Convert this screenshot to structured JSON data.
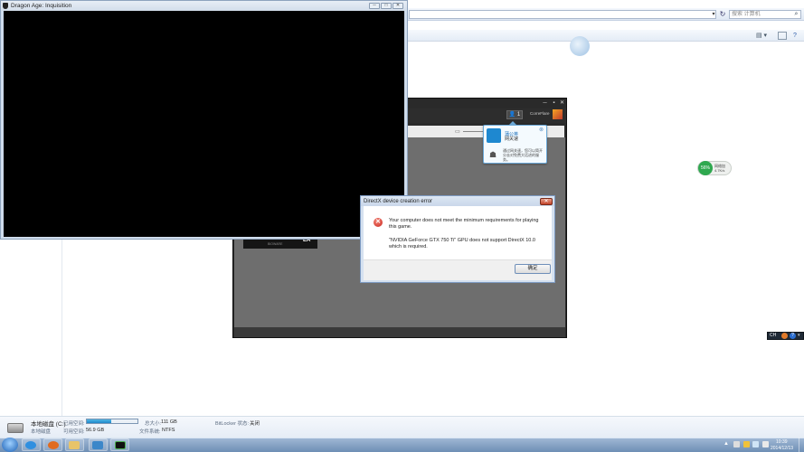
{
  "game_window": {
    "title": "Dragon Age: Inquisition",
    "min_label": "─",
    "max_label": "□",
    "close_label": "✕"
  },
  "explorer": {
    "search_placeholder": "搜索 计算机",
    "refresh_label": "↻",
    "address_dropdown": "▾",
    "view_label": "▤ ▾",
    "help_label": "?"
  },
  "drive": {
    "name": "本地磁盘 (C:)",
    "used_label": "已用空间:",
    "used_fraction": 0.49,
    "total_label": "总大小:",
    "total_value": "111 GB",
    "bitlocker_label": "BitLocker 状态:",
    "bitlocker_value": "关闭",
    "type": "本地磁盘",
    "free_label": "可用空间:",
    "free_value": "56.9 GB",
    "fs_label": "文件系统:",
    "fs_value": "NTFS"
  },
  "launcher": {
    "min_label": "─",
    "max_label": "▪",
    "close_label": "✕",
    "user_btn": "👤 1",
    "user_name": "CorreFlare",
    "banner_text": "BIOWARE",
    "banner_brand": "EA"
  },
  "tooltip": {
    "close_label": "⊗",
    "title": "蒲公英",
    "subtitle": "网关速",
    "body": "通过网关速，您可以简开分去对免费大话进的服务。"
  },
  "gauge": {
    "value": "56%",
    "line1": "网络加",
    "line2": "4.7K/s"
  },
  "dialog": {
    "title": "DirectX device creation error",
    "close_label": "✕",
    "message1": "Your computer does not meet the minimum requirements for playing this game.",
    "message2": "\"NVIDIA GeForce GTX 750 Ti\" GPU does not support DirectX 10.0 which is required.",
    "ok_label": "确定"
  },
  "langbar": {
    "lang": "CH",
    "help": "?",
    "opts": "▾"
  },
  "taskbar": {
    "show_hidden": "▲",
    "time": "10:39",
    "date": "2014/12/13"
  }
}
